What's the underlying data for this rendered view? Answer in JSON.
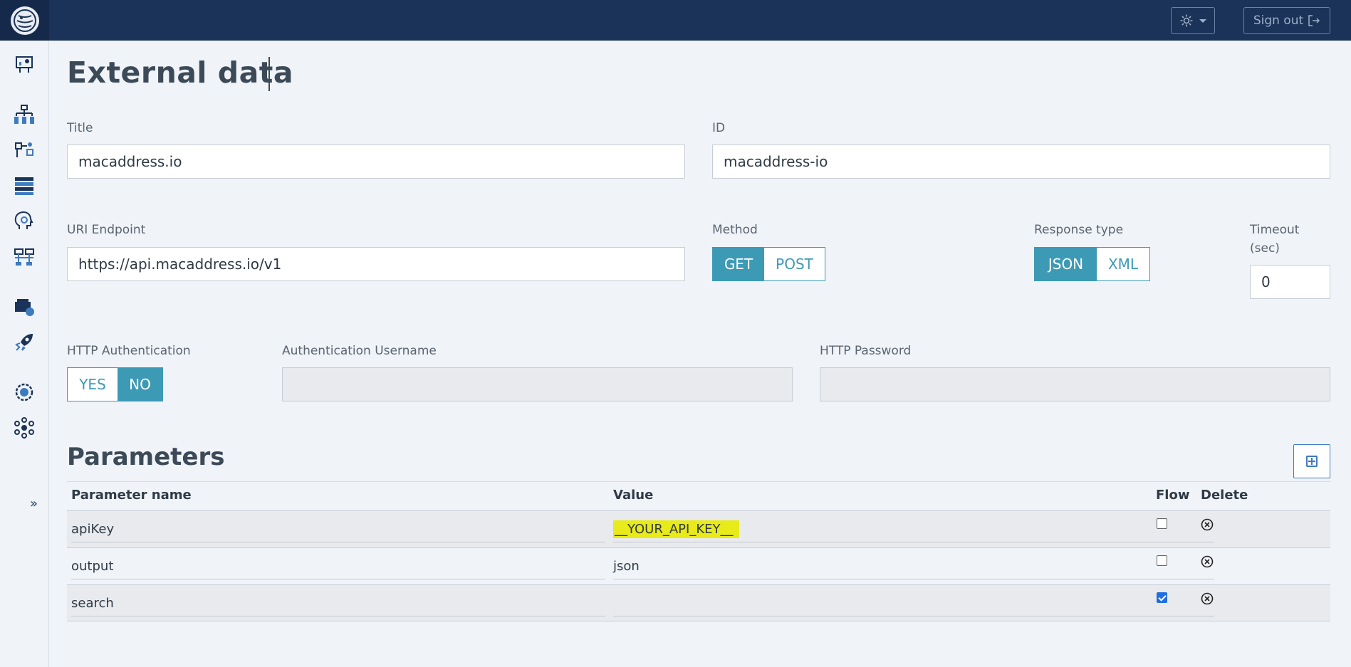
{
  "header": {
    "sign_out_label": "Sign out"
  },
  "page": {
    "title": "External data"
  },
  "form": {
    "title_label": "Title",
    "title_value": "macaddress.io",
    "id_label": "ID",
    "id_value": "macaddress-io",
    "uri_label": "URI Endpoint",
    "uri_value": "https://api.macaddress.io/v1",
    "method_label": "Method",
    "method_options": [
      "GET",
      "POST"
    ],
    "method_selected": "GET",
    "response_label": "Response type",
    "response_options": [
      "JSON",
      "XML"
    ],
    "response_selected": "JSON",
    "timeout_label_1": "Timeout",
    "timeout_label_2": "(sec)",
    "timeout_value": "0",
    "http_auth_label": "HTTP Authentication",
    "http_auth_options": [
      "YES",
      "NO"
    ],
    "http_auth_selected": "NO",
    "auth_user_label": "Authentication Username",
    "auth_user_value": "",
    "http_password_label": "HTTP Password",
    "http_password_value": ""
  },
  "parameters": {
    "title": "Parameters",
    "columns": [
      "Parameter name",
      "Value",
      "Flow",
      "Delete"
    ],
    "rows": [
      {
        "name": "apiKey",
        "value": "__YOUR_API_KEY__",
        "flow": false,
        "highlighted": true
      },
      {
        "name": "output",
        "value": "json",
        "flow": false,
        "highlighted": false
      },
      {
        "name": "search",
        "value": "",
        "flow": true,
        "highlighted": false
      }
    ]
  },
  "sidebar": {
    "icons": [
      "dashboard-icon",
      "hierarchy-icon",
      "flow-icon",
      "database-icon",
      "ai-head-icon",
      "network-icon",
      "connector-icon",
      "rocket-icon",
      "global-settings-icon",
      "molecule-icon"
    ],
    "expand_label": "»"
  },
  "colors": {
    "topbar": "#1b3358",
    "accent": "#3d9ab5",
    "highlight": "#e8ea1a"
  }
}
